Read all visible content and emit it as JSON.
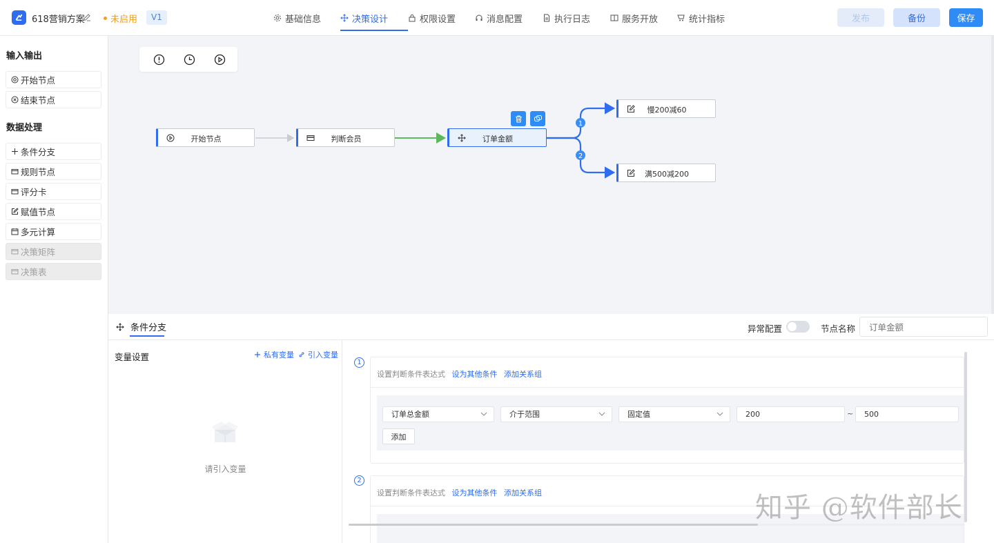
{
  "header": {
    "app_name": "618营销方案",
    "status": "未启用",
    "version": "V1",
    "tabs": [
      {
        "label": "基础信息",
        "icon": "gear-icon"
      },
      {
        "label": "决策设计",
        "icon": "move-icon"
      },
      {
        "label": "权限设置",
        "icon": "lock-icon"
      },
      {
        "label": "消息配置",
        "icon": "headset-icon"
      },
      {
        "label": "执行日志",
        "icon": "document-icon"
      },
      {
        "label": "服务开放",
        "icon": "book-icon"
      },
      {
        "label": "统计指标",
        "icon": "cart-icon"
      }
    ],
    "active_tab": "决策设计",
    "publish_label": "发布",
    "backup_label": "备份",
    "save_label": "保存"
  },
  "sidebar": {
    "section_io": "输入输出",
    "io_items": [
      {
        "label": "开始节点",
        "icon": "start-circle-icon"
      },
      {
        "label": "结束节点",
        "icon": "end-circle-icon"
      }
    ],
    "section_data": "数据处理",
    "data_items": [
      {
        "label": "条件分支",
        "icon": "branch-move-icon",
        "disabled": false
      },
      {
        "label": "规则节点",
        "icon": "card-icon",
        "disabled": false
      },
      {
        "label": "评分卡",
        "icon": "card-icon",
        "disabled": false
      },
      {
        "label": "赋值节点",
        "icon": "edit-square-icon",
        "disabled": false
      },
      {
        "label": "多元计算",
        "icon": "calendar-icon",
        "disabled": false
      },
      {
        "label": "决策矩阵",
        "icon": "card-icon",
        "disabled": true
      },
      {
        "label": "决策表",
        "icon": "card-icon",
        "disabled": true
      }
    ]
  },
  "canvas": {
    "toolbar": [
      "info-icon",
      "clock-icon",
      "play-icon"
    ],
    "nodes": {
      "start": "开始节点",
      "member": "判断会员",
      "amount": "订单金额",
      "branch1": "慢200减60",
      "branch2": "满500减200"
    },
    "branch_numbers": [
      "1",
      "2"
    ],
    "colors": {
      "accent": "#2f6cf0",
      "green_edge": "#5cb85c",
      "gray_edge": "#c9ccd2"
    }
  },
  "panel": {
    "tab_label": "条件分支",
    "exception_label": "异常配置",
    "exception_enabled": false,
    "node_name_label": "节点名称",
    "node_name_value": "订单金额"
  },
  "variables": {
    "title": "变量设置",
    "private_var": "私有变量",
    "import_var": "引入变量",
    "empty_text": "请引入变量"
  },
  "conditions": [
    {
      "number": "1",
      "header": "设置判断条件表达式",
      "set_other": "设为其他条件",
      "add_group": "添加关系组",
      "field": "订单总金额",
      "operator": "介于范围",
      "value_type": "固定值",
      "min": "200",
      "tilde": "~",
      "max": "500",
      "add_label": "添加"
    },
    {
      "number": "2",
      "header": "设置判断条件表达式",
      "set_other": "设为其他条件",
      "add_group": "添加关系组"
    }
  ],
  "watermark": "知乎 @软件部长"
}
